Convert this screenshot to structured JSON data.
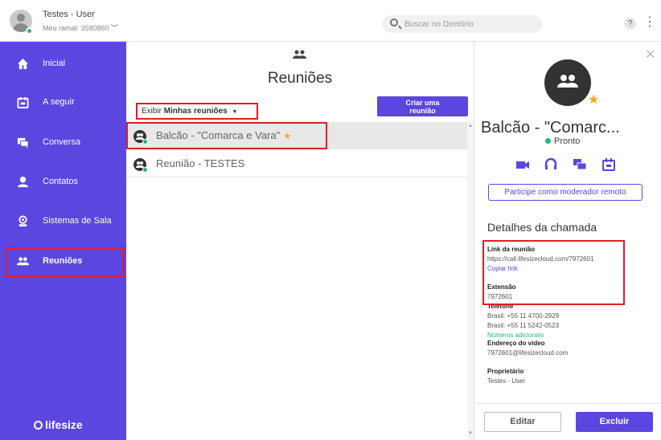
{
  "user": {
    "name": "Testes - User",
    "extension": "Meu ramal: 3580860"
  },
  "search": {
    "placeholder": "Buscar no Diretório"
  },
  "topbar": {
    "help_label": "?",
    "more_label": "⋮"
  },
  "sidebar": {
    "items": [
      {
        "label": "Inicial",
        "icon": "home-icon"
      },
      {
        "label": "A seguir",
        "icon": "calendar-icon"
      },
      {
        "label": "Conversa",
        "icon": "chat-icon"
      },
      {
        "label": "Contatos",
        "icon": "contact-icon"
      },
      {
        "label": "Sistemas de Sala",
        "icon": "room-system-icon"
      },
      {
        "label": "Reuniões",
        "icon": "meetings-icon",
        "active": true
      }
    ],
    "logo": "lifesize"
  },
  "meetings": {
    "title": "Reuniões",
    "filter_prefix": "Exibir",
    "filter_value": "Minhas reuniões",
    "create_line1": "Criar uma",
    "create_line2": "reunião",
    "list": [
      {
        "name": "Balcão - \"Comarca e Vara\"",
        "favorite": true,
        "selected": true
      },
      {
        "name": "Reunião - TESTES",
        "favorite": false,
        "selected": false
      }
    ]
  },
  "details": {
    "room_name": "Balcão - \"Comarc...",
    "status": "Pronto",
    "moderator_button": "Participe como moderador remoto",
    "section_title": "Detalhes da chamada",
    "link_label": "Link da reunião",
    "link_value": "https://call.lifesizecloud.com/7972601",
    "copy_link": "Copiar link",
    "extension_label": "Extensão",
    "extension_value": "7972601",
    "phone_label": "Telefone",
    "phone_1": "Brasil: +55 11 4700-2929",
    "phone_2": "Brasil: +55 11 5242-0523",
    "more_numbers": "Números adicionais",
    "video_label": "Endereço do vídeo",
    "video_value": "7972601@lifesizecloud.com",
    "owner_label": "Proprietário",
    "owner_value": "Testes - User",
    "edit_label": "Editar",
    "delete_label": "Excluir"
  },
  "colors": {
    "accent": "#5b46e0",
    "highlight": "#e11d24",
    "online": "#2bb673",
    "favorite": "#f5a623"
  }
}
